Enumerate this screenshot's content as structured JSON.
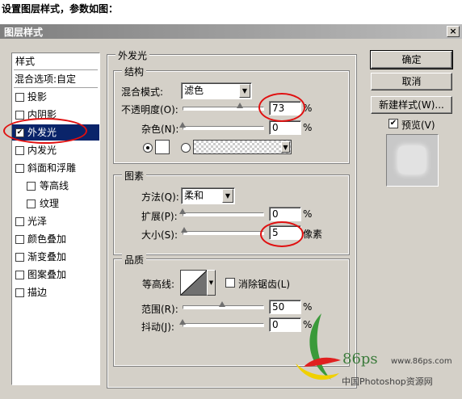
{
  "caption": "设置图层样式，参数如图：",
  "dialog": {
    "title": "图层样式",
    "close": "×"
  },
  "left_panel": {
    "header": "样式",
    "blend_options": "混合选项:自定",
    "items": [
      {
        "label": "投影",
        "checked": false,
        "indent": false
      },
      {
        "label": "内阴影",
        "checked": false,
        "indent": false
      },
      {
        "label": "外发光",
        "checked": true,
        "indent": false,
        "selected": true
      },
      {
        "label": "内发光",
        "checked": false,
        "indent": false
      },
      {
        "label": "斜面和浮雕",
        "checked": false,
        "indent": false
      },
      {
        "label": "等高线",
        "checked": false,
        "indent": true
      },
      {
        "label": "纹理",
        "checked": false,
        "indent": true
      },
      {
        "label": "光泽",
        "checked": false,
        "indent": false
      },
      {
        "label": "颜色叠加",
        "checked": false,
        "indent": false
      },
      {
        "label": "渐变叠加",
        "checked": false,
        "indent": false
      },
      {
        "label": "图案叠加",
        "checked": false,
        "indent": false
      },
      {
        "label": "描边",
        "checked": false,
        "indent": false
      }
    ]
  },
  "outer_glow": {
    "title": "外发光",
    "structure": {
      "title": "结构",
      "blend_mode_label": "混合模式:",
      "blend_mode_value": "滤色",
      "opacity_label": "不透明度(O):",
      "opacity_value": "73",
      "opacity_unit": "%",
      "opacity_level": 0.73,
      "noise_label": "杂色(N):",
      "noise_value": "0",
      "noise_unit": "%",
      "noise_level": 0
    },
    "elements": {
      "title": "图素",
      "method_label": "方法(Q):",
      "method_value": "柔和",
      "spread_label": "扩展(P):",
      "spread_value": "0",
      "spread_unit": "%",
      "spread_level": 0,
      "size_label": "大小(S):",
      "size_value": "5",
      "size_unit": "像素",
      "size_level": 0.02
    },
    "quality": {
      "title": "品质",
      "contour_label": "等高线:",
      "antialias_label": "消除锯齿(L)",
      "antialias_checked": false,
      "range_label": "范围(R):",
      "range_value": "50",
      "range_unit": "%",
      "range_level": 0.5,
      "jitter_label": "抖动(J):",
      "jitter_value": "0",
      "jitter_unit": "%",
      "jitter_level": 0
    }
  },
  "buttons": {
    "ok": "确定",
    "cancel": "取消",
    "new_style": "新建样式(W)...",
    "preview_label": "预览(V)",
    "preview_checked": true
  },
  "watermark": {
    "brand": "86ps",
    "url": "www.86ps.com",
    "site": "中国Photoshop资源网"
  },
  "colors": {
    "highlight": "#0a246a",
    "annotation": "#e01010",
    "dialog_bg": "#d4d0c8"
  }
}
